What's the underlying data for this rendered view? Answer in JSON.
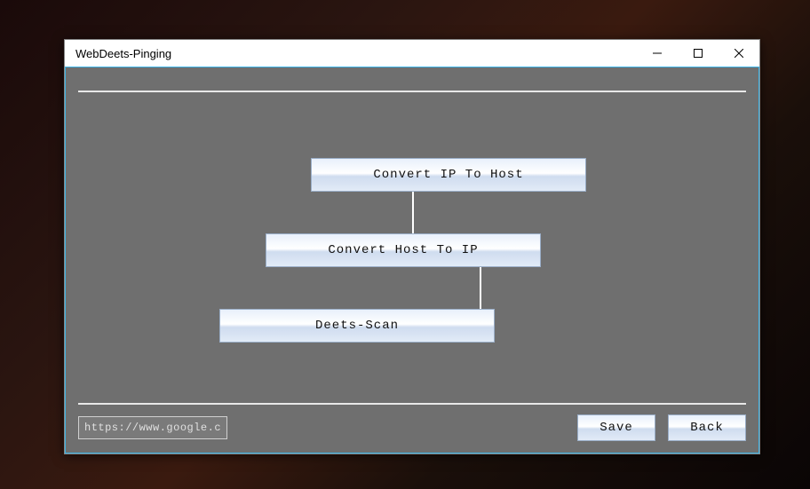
{
  "window": {
    "title": "WebDeets-Pinging"
  },
  "actions": {
    "ip_to_host": "Convert IP To Host",
    "host_to_ip": "Convert Host To IP",
    "scan": "Deets-Scan"
  },
  "footer": {
    "url_value": "https://www.google.com",
    "save_label": "Save",
    "back_label": "Back"
  }
}
